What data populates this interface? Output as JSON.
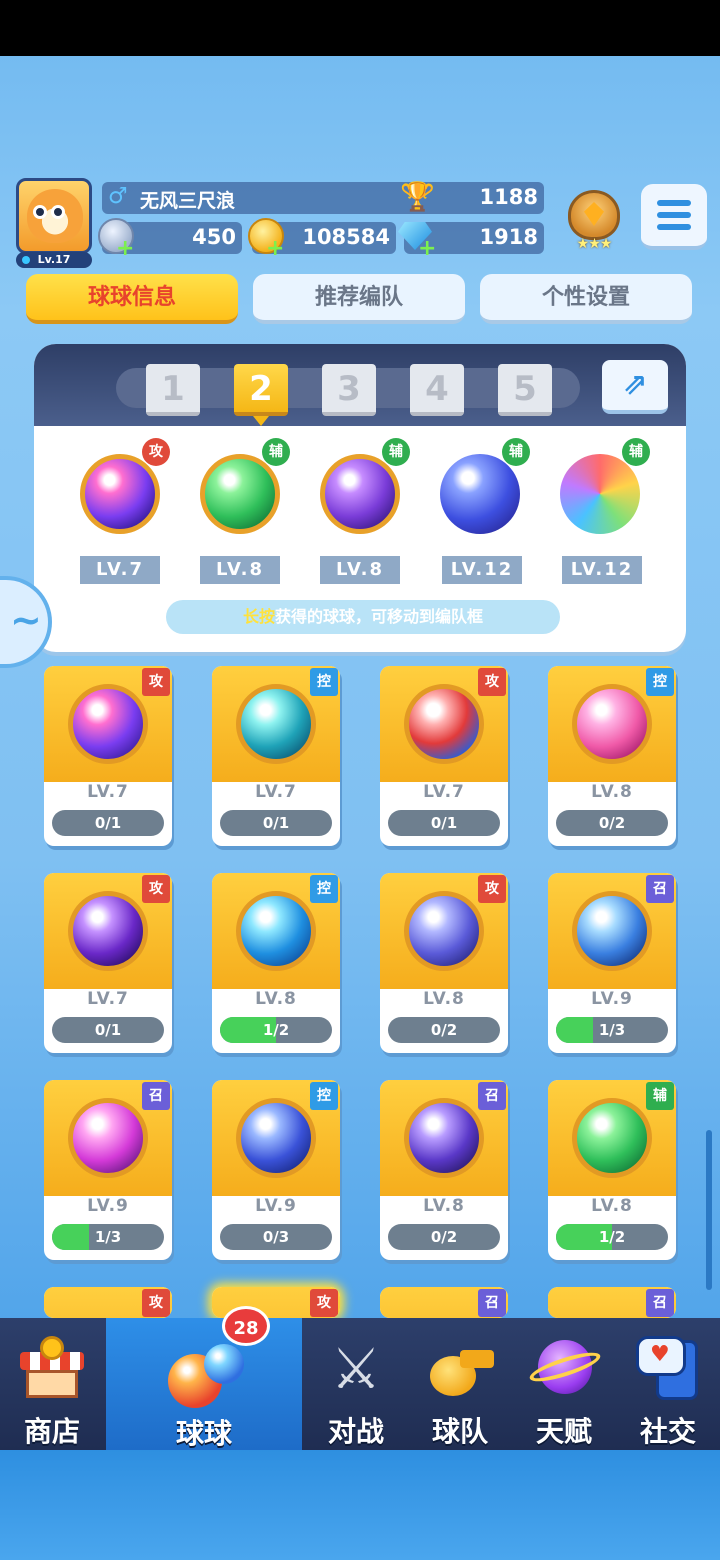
{
  "player": {
    "name": "无风三尺浪",
    "level": "Lv.17",
    "gender_icon": "male-icon",
    "trophies": "1188",
    "silver": "450",
    "gold": "108584",
    "gems": "1918"
  },
  "tabs": [
    {
      "label": "球球信息",
      "active": true
    },
    {
      "label": "推荐编队",
      "active": false
    },
    {
      "label": "个性设置",
      "active": false
    }
  ],
  "formation": {
    "slots": [
      "1",
      "2",
      "3",
      "4",
      "5"
    ],
    "selected_slot": "2",
    "balls": [
      {
        "role": "攻",
        "level": "LV.7"
      },
      {
        "role": "辅",
        "level": "LV.8"
      },
      {
        "role": "辅",
        "level": "LV.8"
      },
      {
        "role": "辅",
        "level": "LV.12"
      },
      {
        "role": "辅",
        "level": "LV.12"
      }
    ],
    "hint_highlight": "长按",
    "hint_text": "获得的球球，可移动到编队框"
  },
  "collection": [
    {
      "role": "攻",
      "level": "LV.7",
      "progress": "0/1",
      "fill": 0
    },
    {
      "role": "控",
      "level": "LV.7",
      "progress": "0/1",
      "fill": 0
    },
    {
      "role": "攻",
      "level": "LV.7",
      "progress": "0/1",
      "fill": 0
    },
    {
      "role": "控",
      "level": "LV.8",
      "progress": "0/2",
      "fill": 0
    },
    {
      "role": "攻",
      "level": "LV.7",
      "progress": "0/1",
      "fill": 0
    },
    {
      "role": "控",
      "level": "LV.8",
      "progress": "1/2",
      "fill": 0.5
    },
    {
      "role": "攻",
      "level": "LV.8",
      "progress": "0/2",
      "fill": 0
    },
    {
      "role": "召",
      "level": "LV.9",
      "progress": "1/3",
      "fill": 0.333
    },
    {
      "role": "召",
      "level": "LV.9",
      "progress": "1/3",
      "fill": 0.333
    },
    {
      "role": "控",
      "level": "LV.9",
      "progress": "0/3",
      "fill": 0
    },
    {
      "role": "召",
      "level": "LV.8",
      "progress": "0/2",
      "fill": 0
    },
    {
      "role": "辅",
      "level": "LV.8",
      "progress": "1/2",
      "fill": 0.5
    }
  ],
  "collection_next_row_roles": [
    "攻",
    "攻",
    "召",
    "召"
  ],
  "nav": [
    {
      "label": "商店",
      "icon": "shop-icon"
    },
    {
      "label": "球球",
      "icon": "ball-icon",
      "active": true,
      "badge": "28"
    },
    {
      "label": "对战",
      "icon": "crossed-swords-icon"
    },
    {
      "label": "球队",
      "icon": "whistle-icon"
    },
    {
      "label": "天赋",
      "icon": "planet-icon"
    },
    {
      "label": "社交",
      "icon": "chat-phone-icon"
    }
  ],
  "colors": {
    "attack": "#e04a3a",
    "control": "#2f9be6",
    "support": "#2fae4f",
    "summon": "#6b5fd8",
    "accent_yellow": "#ffc21a"
  }
}
